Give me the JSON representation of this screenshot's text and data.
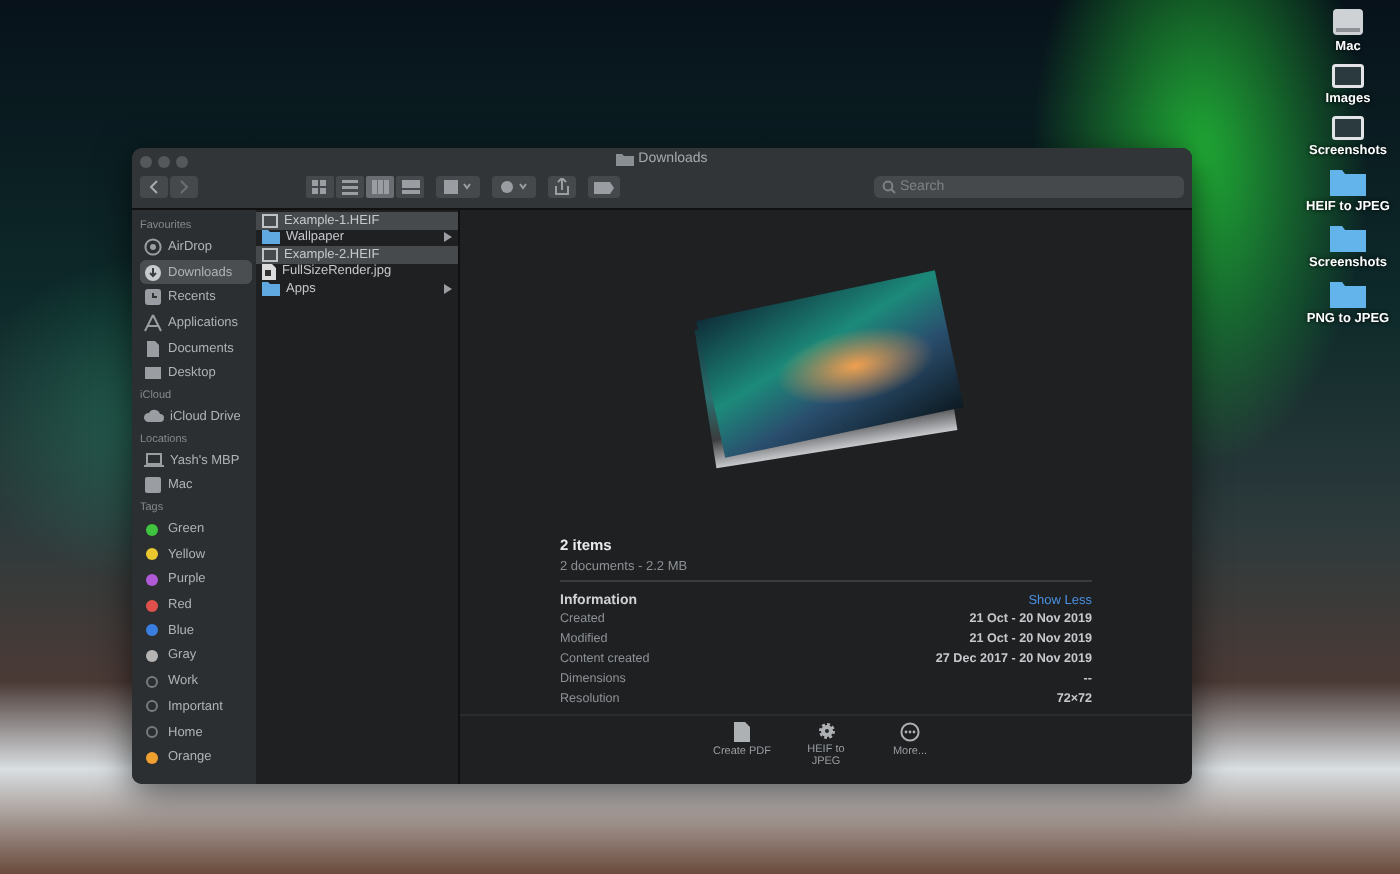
{
  "window": {
    "title": "Downloads"
  },
  "toolbar": {
    "view_modes": [
      {
        "selected": false
      },
      {
        "selected": false
      },
      {
        "selected": true
      },
      {
        "selected": false
      }
    ],
    "search": {
      "placeholder": "Search"
    }
  },
  "sidebar": {
    "sections": [
      {
        "heading": "Favourites",
        "items": [
          {
            "label": "AirDrop",
            "selected": false
          },
          {
            "label": "Downloads",
            "selected": true
          },
          {
            "label": "Recents",
            "selected": false
          },
          {
            "label": "Applications",
            "selected": false
          },
          {
            "label": "Documents",
            "selected": false
          },
          {
            "label": "Desktop",
            "selected": false
          }
        ]
      },
      {
        "heading": "iCloud",
        "items": [
          {
            "label": "iCloud Drive",
            "selected": false
          }
        ]
      },
      {
        "heading": "Locations",
        "items": [
          {
            "label": "Yash's MBP",
            "selected": false
          },
          {
            "label": "Mac",
            "selected": false
          }
        ]
      },
      {
        "heading": "Tags",
        "items": [
          {
            "label": "Green",
            "color": "#3ec43e",
            "selected": false
          },
          {
            "label": "Yellow",
            "color": "#e8c82e",
            "selected": false
          },
          {
            "label": "Purple",
            "color": "#b05ad6",
            "selected": false
          },
          {
            "label": "Red",
            "color": "#e0504a",
            "selected": false
          },
          {
            "label": "Blue",
            "color": "#3a7fe0",
            "selected": false
          },
          {
            "label": "Gray",
            "color": "#b4b4b4",
            "selected": false
          },
          {
            "label": "Work",
            "selected": false
          },
          {
            "label": "Important",
            "selected": false
          },
          {
            "label": "Home",
            "selected": false
          },
          {
            "label": "Orange",
            "color": "#f0a030",
            "selected": false
          }
        ]
      }
    ]
  },
  "files": [
    {
      "name": "Example-1.HEIF",
      "kind": "image",
      "selected": true
    },
    {
      "name": "Wallpaper",
      "kind": "folder",
      "selected": false
    },
    {
      "name": "Example-2.HEIF",
      "kind": "image",
      "selected": true
    },
    {
      "name": "FullSizeRender.jpg",
      "kind": "document",
      "selected": false
    },
    {
      "name": "Apps",
      "kind": "folder",
      "selected": false
    }
  ],
  "preview": {
    "title": "2 items",
    "subtitle": "2 documents - 2.2 MB",
    "section": "Information",
    "toggle": "Show Less",
    "rows": [
      {
        "key": "Created",
        "value": "21 Oct - 20 Nov 2019"
      },
      {
        "key": "Modified",
        "value": "21 Oct - 20 Nov 2019"
      },
      {
        "key": "Content created",
        "value": "27 Dec 2017 - 20 Nov 2019"
      },
      {
        "key": "Dimensions",
        "value": "--"
      },
      {
        "key": "Resolution",
        "value": "72×72"
      }
    ],
    "actions": [
      "Create PDF",
      "HEIF to JPEG",
      "More..."
    ]
  },
  "desktop_icons": [
    {
      "label": "Mac",
      "kind": "drive"
    },
    {
      "label": "Images",
      "kind": "screen"
    },
    {
      "label": "Screenshots",
      "kind": "screen"
    },
    {
      "label": "HEIF to JPEG",
      "kind": "folder"
    },
    {
      "label": "Screenshots",
      "kind": "folder"
    },
    {
      "label": "PNG to JPEG",
      "kind": "folder"
    }
  ]
}
